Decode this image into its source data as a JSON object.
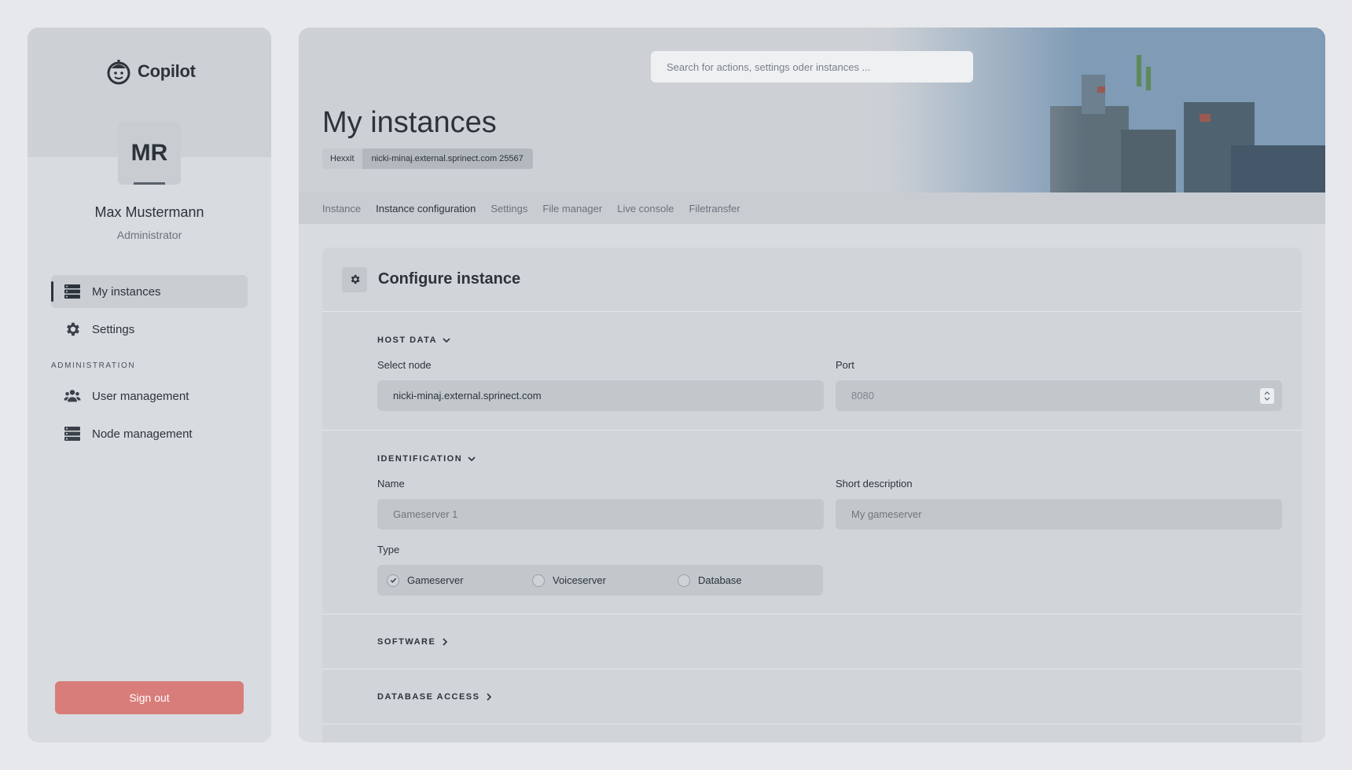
{
  "app": {
    "logo_text": "Copilot"
  },
  "user": {
    "initials": "MR",
    "name": "Max Mustermann",
    "role": "Administrator"
  },
  "sidebar": {
    "items": [
      {
        "label": "My instances",
        "icon": "server-icon",
        "active": true
      },
      {
        "label": "Settings",
        "icon": "gear-icon",
        "active": false
      }
    ],
    "admin_section_label": "ADMINISTRATION",
    "admin_items": [
      {
        "label": "User management",
        "icon": "users-icon"
      },
      {
        "label": "Node management",
        "icon": "server-icon"
      }
    ],
    "signout_label": "Sign out"
  },
  "header": {
    "search_placeholder": "Search for actions, settings oder instances ...",
    "title": "My instances",
    "badges": [
      "Hexxit",
      "nicki-minaj.external.sprinect.com 25567"
    ]
  },
  "tabs": [
    {
      "label": "Instance",
      "active": false
    },
    {
      "label": "Instance configuration",
      "active": true
    },
    {
      "label": "Settings",
      "active": false
    },
    {
      "label": "File manager",
      "active": false
    },
    {
      "label": "Live console",
      "active": false
    },
    {
      "label": "Filetransfer",
      "active": false
    }
  ],
  "card": {
    "title": "Configure instance",
    "host_data": {
      "title": "HOST DATA",
      "node_label": "Select node",
      "node_value": "nicki-minaj.external.sprinect.com",
      "port_label": "Port",
      "port_placeholder": "8080"
    },
    "identification": {
      "title": "IDENTIFICATION",
      "name_label": "Name",
      "name_placeholder": "Gameserver 1",
      "desc_label": "Short description",
      "desc_placeholder": "My gameserver",
      "type_label": "Type",
      "type_options": [
        {
          "label": "Gameserver",
          "checked": true
        },
        {
          "label": "Voiceserver",
          "checked": false
        },
        {
          "label": "Database",
          "checked": false
        }
      ]
    },
    "software": {
      "title": "SOFTWARE"
    },
    "database_access": {
      "title": "DATABASE ACCESS"
    }
  }
}
